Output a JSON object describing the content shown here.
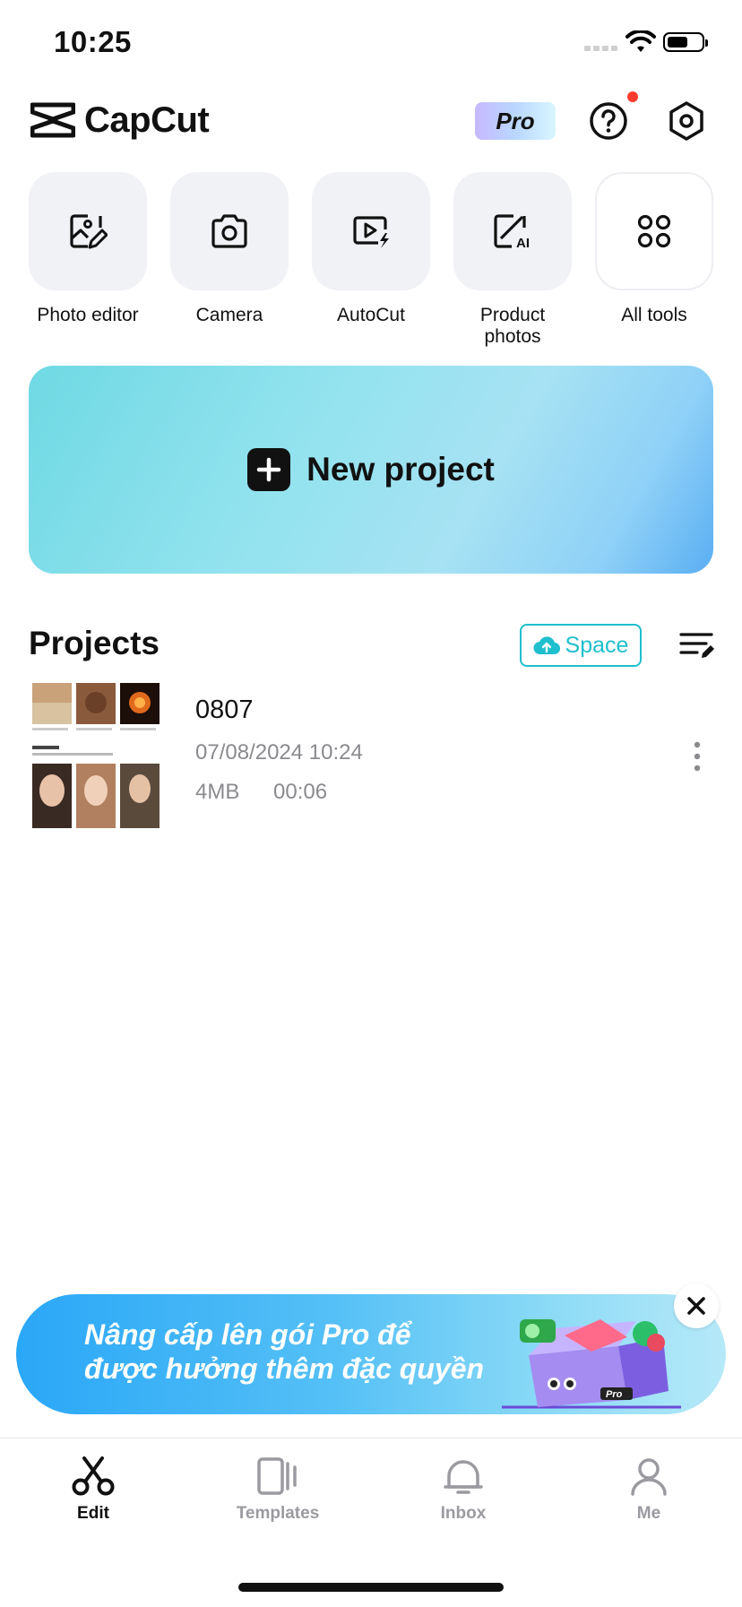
{
  "status_bar": {
    "time": "10:25"
  },
  "header": {
    "brand": "CapCut",
    "pro_label": "Pro"
  },
  "tools": [
    {
      "label": "Photo editor",
      "icon": "photo-edit-icon"
    },
    {
      "label": "Camera",
      "icon": "camera-icon"
    },
    {
      "label": "AutoCut",
      "icon": "autocut-icon"
    },
    {
      "label": "Product\nphotos",
      "icon": "product-photos-ai-icon"
    },
    {
      "label": "All tools",
      "icon": "grid-icon"
    }
  ],
  "new_project": {
    "label": "New project"
  },
  "projects": {
    "title": "Projects",
    "space_label": "Space",
    "items": [
      {
        "name": "0807",
        "date": "07/08/2024 10:24",
        "size": "4MB",
        "duration": "00:06"
      }
    ]
  },
  "promo": {
    "text": "Nâng cấp lên gói Pro để\nđược hưởng thêm đặc quyền",
    "art_badge": "Pro"
  },
  "tabbar": {
    "tabs": [
      {
        "label": "Edit",
        "active": true
      },
      {
        "label": "Templates",
        "active": false
      },
      {
        "label": "Inbox",
        "active": false
      },
      {
        "label": "Me",
        "active": false
      }
    ]
  },
  "colors": {
    "accent": "#1fbfce",
    "notification": "#ff3b30",
    "promo_start": "#2aa7f7"
  }
}
